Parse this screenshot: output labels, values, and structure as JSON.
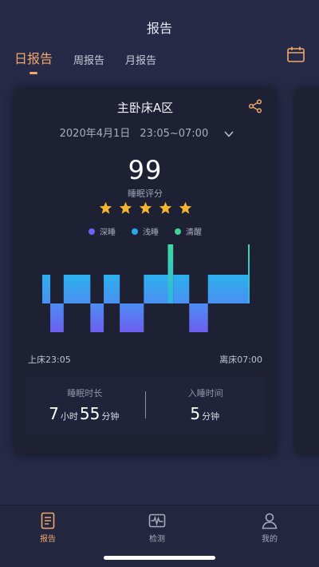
{
  "header": {
    "title": "报告"
  },
  "tabs": [
    {
      "label": "日报告",
      "active": true
    },
    {
      "label": "周报告",
      "active": false
    },
    {
      "label": "月报告",
      "active": false
    }
  ],
  "card": {
    "room": "主卧床A区",
    "date": "2020年4月1日",
    "time_range": "23:05~07:00",
    "score": "99",
    "score_label": "睡眠评分",
    "stars": 5,
    "legend": [
      {
        "label": "深睡",
        "color": "#6b63f0"
      },
      {
        "label": "浅睡",
        "color": "#2aa6ea"
      },
      {
        "label": "清醒",
        "color": "#3fd39a"
      }
    ],
    "bed_in": "上床23:05",
    "bed_out": "离床07:00",
    "duration_label": "睡眠时长",
    "duration_hours": "7",
    "hours_unit": "小时",
    "duration_minutes": "55",
    "minutes_unit": "分钟",
    "onset_label": "入睡时间",
    "onset_minutes": "5",
    "onset_unit": "分钟"
  },
  "chart_data": {
    "type": "bar",
    "levels": [
      "清醒",
      "浅睡",
      "深睡"
    ],
    "segments": [
      {
        "stage": "浅睡",
        "width": 3
      },
      {
        "stage": "深睡",
        "width": 5
      },
      {
        "stage": "浅睡",
        "width": 10
      },
      {
        "stage": "深睡",
        "width": 5
      },
      {
        "stage": "浅睡",
        "width": 6
      },
      {
        "stage": "深睡",
        "width": 9
      },
      {
        "stage": "浅睡",
        "width": 9
      },
      {
        "stage": "清醒",
        "width": 2
      },
      {
        "stage": "浅睡",
        "width": 6
      },
      {
        "stage": "深睡",
        "width": 7
      },
      {
        "stage": "浅睡",
        "width": 15
      },
      {
        "stage": "清醒",
        "width": 0.6
      }
    ]
  },
  "nav": [
    {
      "label": "报告",
      "icon": "report-icon",
      "active": true
    },
    {
      "label": "检测",
      "icon": "monitor-icon",
      "active": false
    },
    {
      "label": "我的",
      "icon": "profile-icon",
      "active": false
    }
  ],
  "colors": {
    "accent": "#f0a76b",
    "star": "#f5b52e"
  }
}
